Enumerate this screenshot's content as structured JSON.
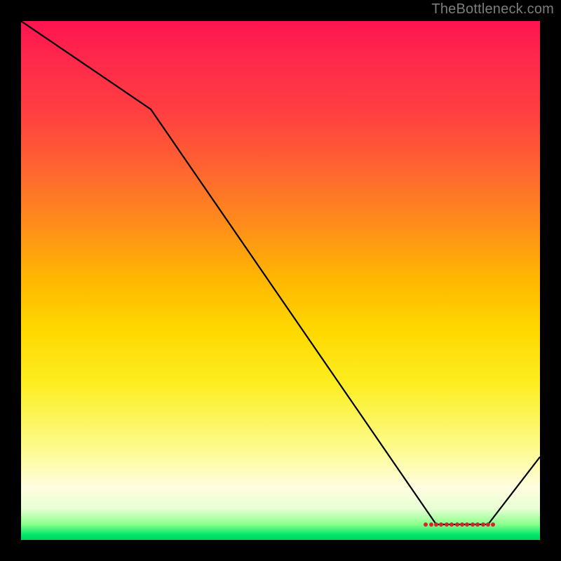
{
  "watermark": "TheBottleneck.com",
  "chart_data": {
    "type": "line",
    "title": "",
    "xlabel": "",
    "ylabel": "",
    "xlim": [
      0,
      100
    ],
    "ylim": [
      0,
      100
    ],
    "series": [
      {
        "name": "curve",
        "x": [
          0,
          25,
          80,
          90,
          100
        ],
        "values": [
          100,
          83,
          3,
          3,
          16
        ]
      }
    ],
    "markers": {
      "y": 3,
      "x": [
        78,
        79,
        80,
        81,
        82,
        83,
        84,
        85,
        86,
        87,
        88,
        89,
        90,
        91
      ]
    },
    "marker_label": {
      "text": "",
      "x": 84,
      "y": 3.5
    }
  },
  "colors": {
    "curve": "#000000",
    "marker": "#cc2a2a",
    "label": "#3a0a0a"
  }
}
